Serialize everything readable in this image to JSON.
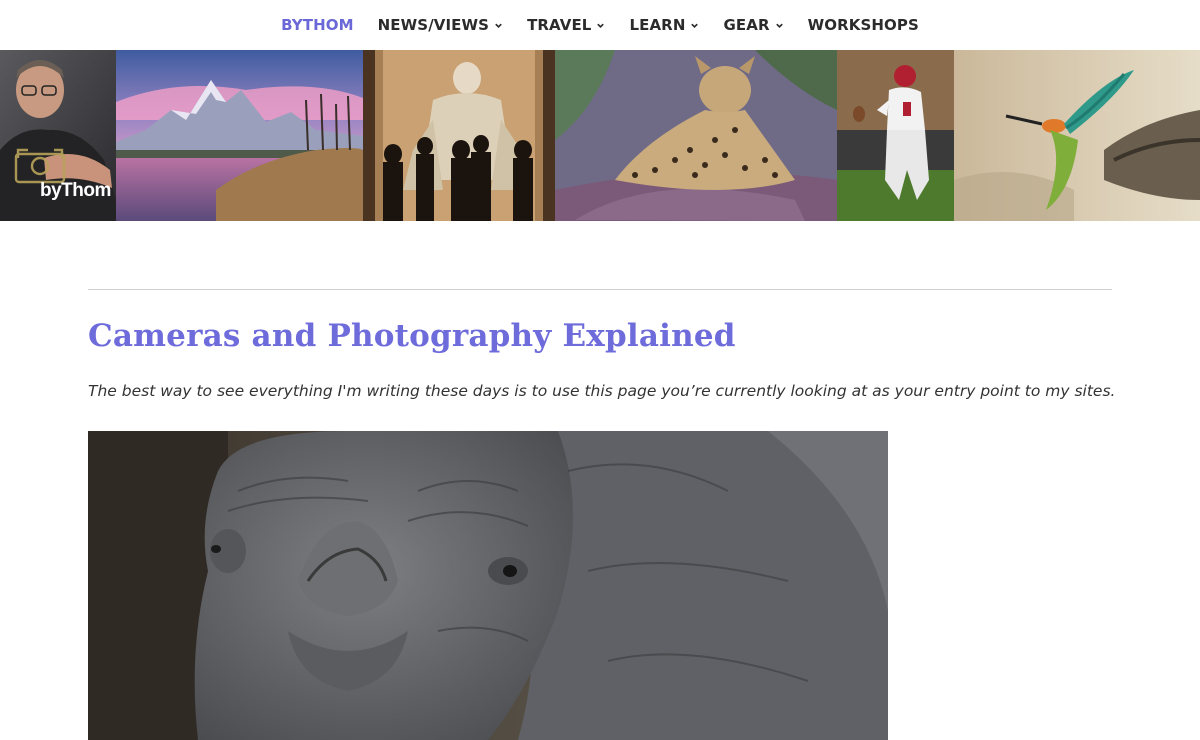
{
  "nav": {
    "items": [
      {
        "label": "BYTHOM",
        "active": true,
        "dropdown": false
      },
      {
        "label": "NEWS/VIEWS",
        "active": false,
        "dropdown": true
      },
      {
        "label": "TRAVEL",
        "active": false,
        "dropdown": true
      },
      {
        "label": "LEARN",
        "active": false,
        "dropdown": true
      },
      {
        "label": "GEAR",
        "active": false,
        "dropdown": true
      },
      {
        "label": "WORKSHOPS",
        "active": false,
        "dropdown": false
      }
    ],
    "active_color": "#6a67d6"
  },
  "banner": {
    "logo_text": "byThom",
    "panels": [
      "portrait-photo",
      "mountain-lake-photo",
      "lincoln-memorial-photo",
      "leopard-photo",
      "football-player-photo",
      "bird-photo"
    ]
  },
  "content": {
    "title": "Cameras and Photography Explained",
    "intro": "The best way to see everything I'm writing these days is to use this page you’re currently looking at as your entry point to my sites.",
    "title_color": "#6e6bdb",
    "hero_image": "rhino-photo"
  }
}
